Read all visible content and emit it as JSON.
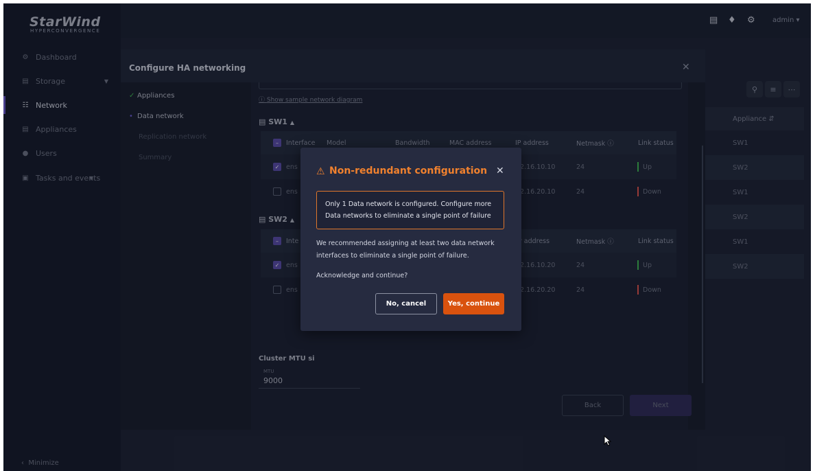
{
  "logo": {
    "brand": "StarWind",
    "sub": "HYPERCONVERGENCE"
  },
  "sidebar": {
    "items": [
      {
        "label": "Dashboard",
        "icon": "dashboard-icon"
      },
      {
        "label": "Storage",
        "icon": "storage-icon"
      },
      {
        "label": "Network",
        "icon": "network-icon"
      },
      {
        "label": "Appliances",
        "icon": "appliances-icon"
      },
      {
        "label": "Users",
        "icon": "users-icon"
      },
      {
        "label": "Tasks and events",
        "icon": "tasks-icon"
      }
    ],
    "minimize": "Minimize"
  },
  "topbar": {
    "user": "admin"
  },
  "bg_table": {
    "header": "Appliance",
    "rows": [
      "SW1",
      "SW2",
      "SW1",
      "SW2",
      "SW1",
      "SW2"
    ]
  },
  "ha": {
    "title": "Configure HA networking",
    "steps": [
      "Appliances",
      "Data network",
      "Replication network",
      "Summary"
    ],
    "diagram_link": "Show sample network diagram",
    "columns": [
      "Interface",
      "Model",
      "Bandwidth",
      "MAC address",
      "IP address",
      "Netmask",
      "Link status"
    ],
    "sw1": {
      "title": "SW1",
      "rows": [
        {
          "iface": "ens",
          "ip": "72.16.10.10",
          "mask": "24",
          "status": "Up"
        },
        {
          "iface": "ens",
          "ip": "72.16.20.10",
          "mask": "24",
          "status": "Down"
        }
      ]
    },
    "sw2": {
      "title": "SW2",
      "rows": [
        {
          "iface": "ens",
          "ip": "72.16.10.20",
          "mask": "24",
          "status": "Up"
        },
        {
          "iface": "ens",
          "ip": "72.16.20.20",
          "mask": "24",
          "status": "Down"
        }
      ]
    },
    "sw2_header_partial": {
      "iface": "Inte",
      "ip": "P address"
    },
    "mtu_label": "Cluster MTU si",
    "mtu_caption": "MTU",
    "mtu_value": "9000",
    "back": "Back",
    "next": "Next"
  },
  "modal": {
    "title": "Non-redundant configuration",
    "alert": "Only 1 Data network is configured. Configure more Data networks to eliminate a single point of failure",
    "body": "We recommended assigning at least two data network interfaces to eliminate a single point of failure.",
    "question": "Acknowledge and continue?",
    "cancel": "No, cancel",
    "continue": "Yes, continue"
  },
  "colors": {
    "accent": "#6a5acd",
    "warning": "#f0812e",
    "primary_button": "#d9520e",
    "up": "#3fb950",
    "down": "#e5534b"
  }
}
